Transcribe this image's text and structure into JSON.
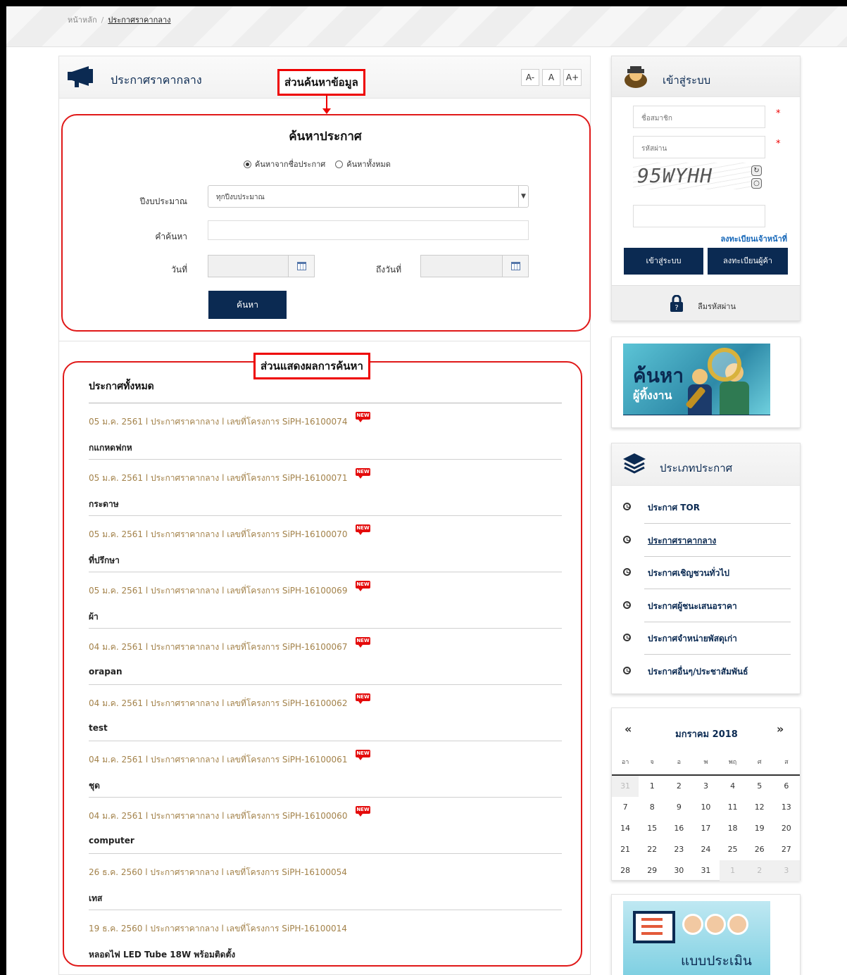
{
  "breadcrumb": {
    "home": "หน้าหลัก",
    "separator": "/",
    "current": "ประกาศราคากลาง"
  },
  "main": {
    "title": "ประกาศราคากลาง",
    "font_buttons": [
      "A-",
      "A",
      "A+"
    ],
    "callout_search": "ส่วนค้นหาข้อมูล",
    "callout_results": "ส่วนแสดงผลการค้นหา"
  },
  "search": {
    "title": "ค้นหาประกาศ",
    "radio_by_name": "ค้นหาจากชื่อประกาศ",
    "radio_all": "ค้นหาทั้งหมด",
    "selected_radio": "by_name",
    "fiscal_label": "ปีงบประมาณ",
    "fiscal_value": "ทุกปีงบประมาณ",
    "keyword_label": "คำค้นหา",
    "keyword_value": "",
    "date_from_label": "วันที่",
    "date_to_label": "ถึงวันที่",
    "button": "ค้นหา"
  },
  "results": {
    "heading": "ประกาศทั้งหมด",
    "new_badge": "NEW",
    "items": [
      {
        "meta": "05 ม.ค. 2561 l ประกาศราคากลาง l เลขที่โครงการ SiPH-16100074",
        "title": "กแกหดฟกห",
        "new": true
      },
      {
        "meta": "05 ม.ค. 2561 l ประกาศราคากลาง l เลขที่โครงการ SiPH-16100071",
        "title": "กระดาษ",
        "new": true
      },
      {
        "meta": "05 ม.ค. 2561 l ประกาศราคากลาง l เลขที่โครงการ SiPH-16100070",
        "title": "ที่ปรึกษา",
        "new": true
      },
      {
        "meta": "05 ม.ค. 2561 l ประกาศราคากลาง l เลขที่โครงการ SiPH-16100069",
        "title": "ผ้า",
        "new": true
      },
      {
        "meta": "04 ม.ค. 2561 l ประกาศราคากลาง l เลขที่โครงการ SiPH-16100067",
        "title": "orapan",
        "new": true
      },
      {
        "meta": "04 ม.ค. 2561 l ประกาศราคากลาง l เลขที่โครงการ SiPH-16100062",
        "title": "test",
        "new": true
      },
      {
        "meta": "04 ม.ค. 2561 l ประกาศราคากลาง l เลขที่โครงการ SiPH-16100061",
        "title": "ชุด",
        "new": true
      },
      {
        "meta": "04 ม.ค. 2561 l ประกาศราคากลาง l เลขที่โครงการ SiPH-16100060",
        "title": "computer",
        "new": true
      },
      {
        "meta": "26 ธ.ค. 2560 l ประกาศราคากลาง l เลขที่โครงการ SiPH-16100054",
        "title": "เทส",
        "new": false
      },
      {
        "meta": "19 ธ.ค. 2560 l ประกาศราคากลาง l เลขที่โครงการ SiPH-16100014",
        "title": "หลอดไฟ LED Tube 18W พร้อมติดตั้ง",
        "new": false
      }
    ]
  },
  "login": {
    "title": "เข้าสู่ระบบ",
    "username_placeholder": "ชื่อสมาชิก",
    "password_placeholder": "รหัสผ่าน",
    "required_mark": "*",
    "captcha_text": "95WYHH",
    "captcha_answer": "",
    "register_staff_link": "ลงทะเบียนเจ้าหน้าที่",
    "login_button": "เข้าสู่ระบบ",
    "register_vendor_button": "ลงทะเบียนผู้ค้า",
    "forgot_password": "ลืมรหัสผ่าน"
  },
  "banner_find": {
    "line1": "ค้นหา",
    "line2": "ผู้ทิ้งงาน"
  },
  "types": {
    "title": "ประเภทประกาศ",
    "items": [
      "ประกาศ TOR",
      "ประกาศราคากลาง",
      "ประกาศเชิญชวนทั่วไป",
      "ประกาศผู้ชนะเสนอราคา",
      "ประกาศจำหน่ายพัสดุเก่า",
      "ประกาศอื่นๆ/ประชาสัมพันธ์"
    ],
    "active_index": 1
  },
  "calendar": {
    "prev": "«",
    "next": "»",
    "month_label": "มกราคม 2018",
    "weekdays": [
      "อา",
      "จ",
      "อ",
      "พ",
      "พฤ",
      "ศ",
      "ส"
    ],
    "weeks": [
      [
        "31",
        "1",
        "2",
        "3",
        "4",
        "5",
        "6"
      ],
      [
        "7",
        "8",
        "9",
        "10",
        "11",
        "12",
        "13"
      ],
      [
        "14",
        "15",
        "16",
        "17",
        "18",
        "19",
        "20"
      ],
      [
        "21",
        "22",
        "23",
        "24",
        "25",
        "26",
        "27"
      ],
      [
        "28",
        "29",
        "30",
        "31",
        "1",
        "2",
        "3"
      ]
    ]
  },
  "banner_eval": {
    "text": "แบบประเมิน"
  },
  "colors": {
    "navy": "#0b2a52",
    "annotation_red": "#e00000",
    "meta_gold": "#a3824a",
    "new_red": "#e40b0b"
  }
}
